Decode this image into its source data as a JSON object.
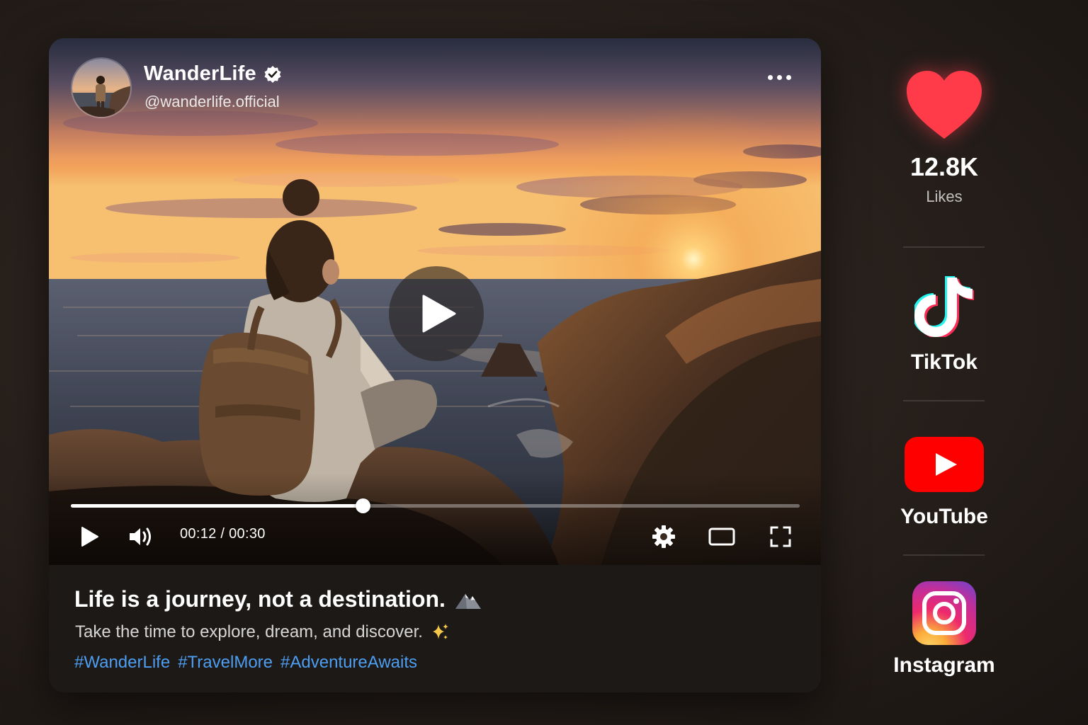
{
  "post": {
    "channel_name": "WanderLife",
    "channel_handle": "@wanderlife.official",
    "verified": true,
    "more_icon": "more-horizontal-icon"
  },
  "player": {
    "current_time": "00:12",
    "duration": "00:30",
    "time_display": "00:12 / 00:30",
    "progress_fraction": 0.4,
    "state": "paused"
  },
  "caption": {
    "title": "Life is a journey, not a destination.",
    "title_emoji": "mountain",
    "subtitle": "Take the time to explore, dream, and discover.",
    "subtitle_emoji": "sparkles",
    "hashtags": [
      "#WanderLife",
      "#TravelMore",
      "#AdventureAwaits"
    ]
  },
  "sidebar": {
    "likes": {
      "count": "12.8K",
      "label": "Likes",
      "icon": "heart-icon",
      "color": "#ff3b4a"
    },
    "platforms": [
      {
        "label": "TikTok",
        "icon": "tiktok-icon"
      },
      {
        "label": "YouTube",
        "icon": "youtube-icon",
        "color": "#ff0000"
      },
      {
        "label": "Instagram",
        "icon": "instagram-icon"
      }
    ]
  },
  "colors": {
    "hashtag": "#4d9ef2",
    "card_bg": "#1d1916"
  }
}
